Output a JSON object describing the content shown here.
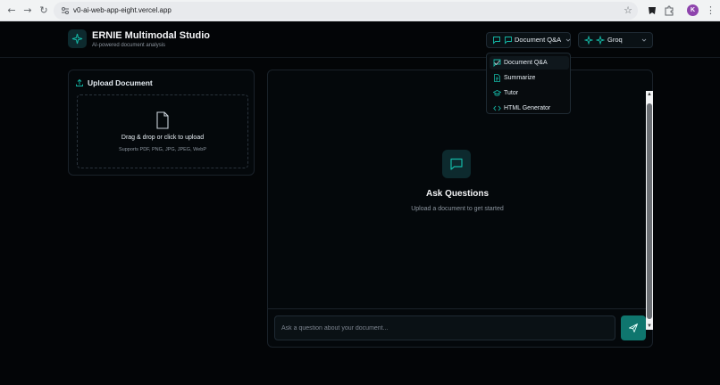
{
  "browser": {
    "url": "v0-ai-web-app-eight.vercel.app",
    "profile_initial": "K"
  },
  "header": {
    "title": "ERNIE Multimodal Studio",
    "subtitle": "AI-powered document analysis"
  },
  "mode_select": {
    "value": "Document Q&A"
  },
  "provider_select": {
    "value": "Groq"
  },
  "mode_menu": {
    "items": [
      {
        "label": "Document Q&A",
        "icon": "message-square-icon",
        "selected": true
      },
      {
        "label": "Summarize",
        "icon": "file-text-icon",
        "selected": false
      },
      {
        "label": "Tutor",
        "icon": "graduation-cap-icon",
        "selected": false
      },
      {
        "label": "HTML Generator",
        "icon": "code-icon",
        "selected": false
      }
    ]
  },
  "upload": {
    "heading": "Upload Document",
    "dropzone_title": "Drag & drop or click to upload",
    "dropzone_formats": "Supports PDF, PNG, JPG, JPEG, WebP"
  },
  "chat": {
    "empty_title": "Ask Questions",
    "empty_subtitle": "Upload a document to get started",
    "input_placeholder": "Ask a question about your document...",
    "input_value": ""
  },
  "colors": {
    "accent": "#14b8a6",
    "send_button": "#0f766e",
    "background": "#030507"
  }
}
